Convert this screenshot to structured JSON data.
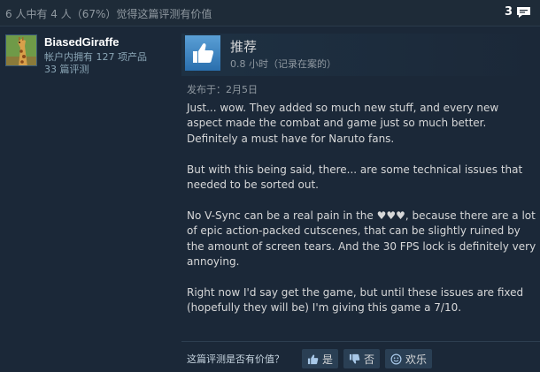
{
  "header": {
    "helpful_text": "6 人中有 4 人（67%）觉得这篇评测有价值",
    "comment_count": "3"
  },
  "author": {
    "username": "BiasedGiraffe",
    "products_owned": "帐户内拥有 127 项产品",
    "reviews": "33 篇评测",
    "avatar_icon": "giraffe-avatar"
  },
  "review": {
    "verdict": "推荐",
    "hours": "0.8 小时（记录在案的）",
    "posted": "发布于：2月5日",
    "paragraphs": [
      "Just... wow. They added so much new stuff, and every new aspect made the combat and game just so much better. Definitely a must have for Naruto fans.",
      "But with this being said, there... are some technical issues that needed to be sorted out.",
      "No V-Sync can be a real pain in the ♥♥♥, because there are a lot of epic action-packed cutscenes, that can be slightly ruined by the amount of screen tears. And the 30 FPS lock is definitely very annoying.",
      "Right now I'd say get the game, but until these issues are fixed (hopefully they will be) I'm giving this game a 7/10."
    ]
  },
  "vote": {
    "prompt": "这篇评测是否有价值？",
    "yes": "是",
    "no": "否",
    "funny": "欢乐"
  },
  "colors": {
    "background": "#1b2838",
    "accent_blue": "#4a90d0",
    "button_bg": "#2a3f54"
  }
}
